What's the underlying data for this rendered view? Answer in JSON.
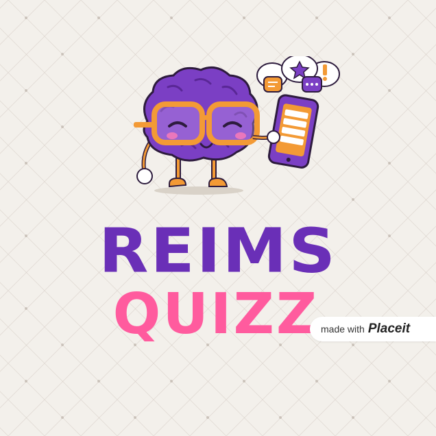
{
  "title_line_1": "REIMS",
  "title_line_2": "QUIZZ",
  "watermark": {
    "prefix": "made with",
    "brand": "Placeit"
  },
  "colors": {
    "background": "#f3f0eb",
    "title_purple": "#6a2fb7",
    "title_pink": "#ff5b9e",
    "brain": "#7b3fc4",
    "glasses": "#f39a35"
  },
  "icons": [
    "brain-mascot-icon",
    "glasses-icon",
    "phone-icon",
    "chat-bubble-icon",
    "star-icon"
  ]
}
